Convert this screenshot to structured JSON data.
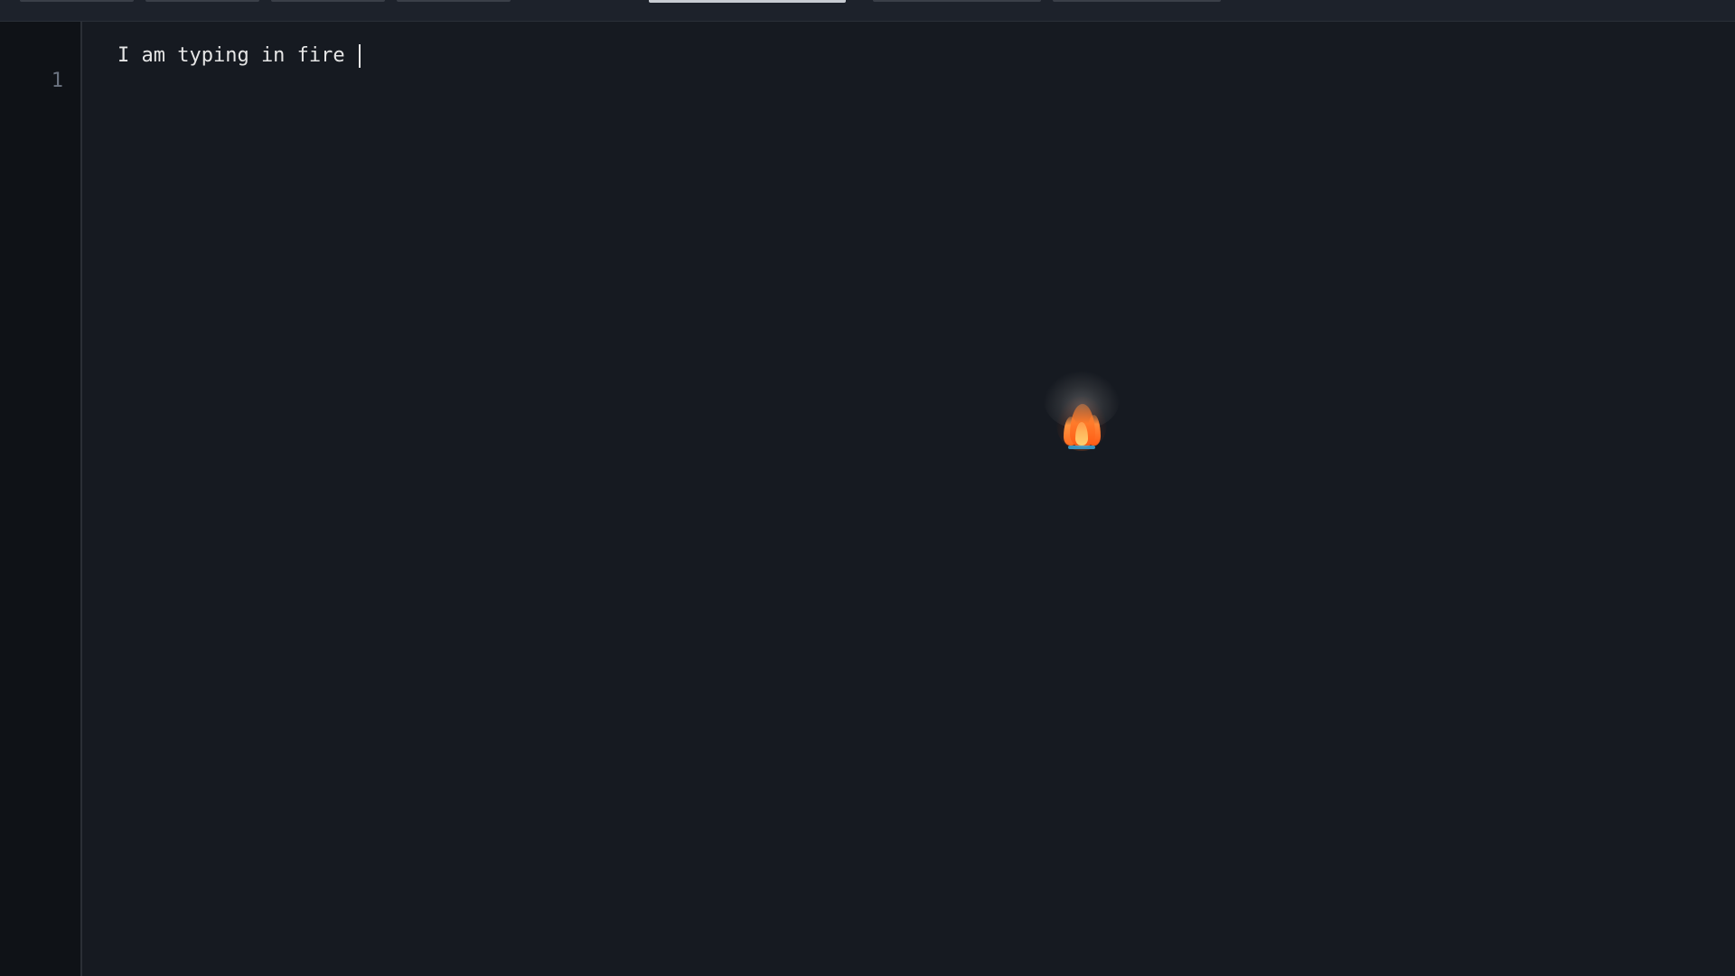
{
  "toolbar": {
    "tabs": [
      {
        "state": "inactive"
      },
      {
        "state": "inactive"
      },
      {
        "state": "inactive"
      },
      {
        "state": "inactive"
      },
      {
        "state": "active"
      },
      {
        "state": "inactive"
      },
      {
        "state": "inactive"
      }
    ]
  },
  "editor": {
    "lines": [
      {
        "number": "1",
        "text": "I am typing in fire "
      }
    ],
    "cursor_line": "1"
  },
  "effects": {
    "fire_icon": "fire-particle-effect"
  },
  "colors": {
    "background": "#161a21",
    "gutter": "#0f1217",
    "text": "#e6e6e6",
    "line_number": "#6b7380",
    "active_tab": "#c8ccd2",
    "fire": "#ff6b1f"
  }
}
